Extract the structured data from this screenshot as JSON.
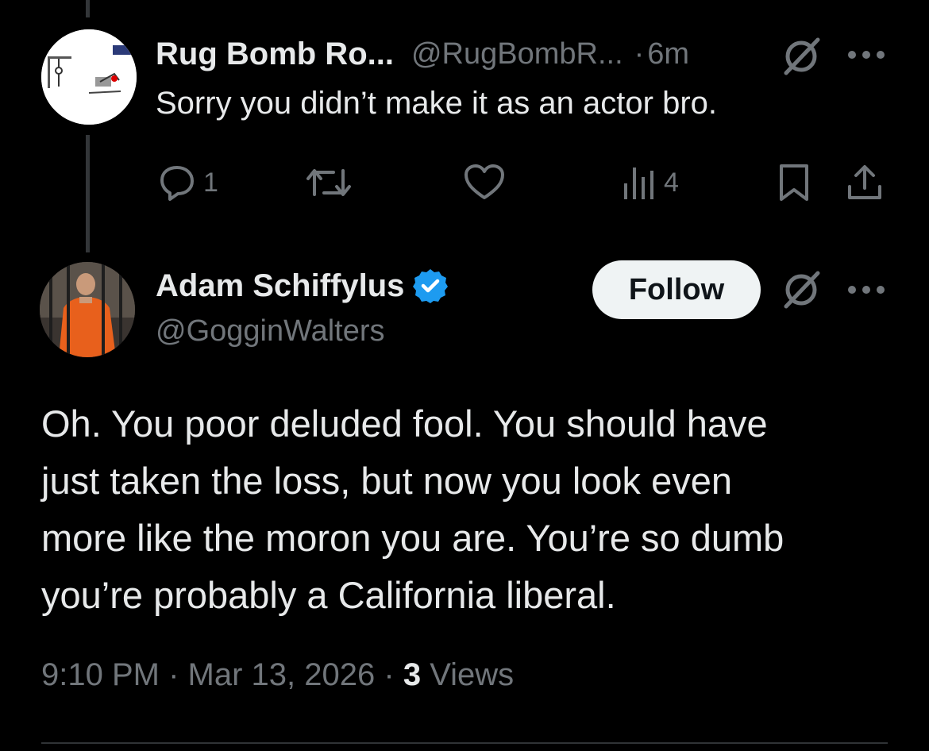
{
  "reply": {
    "display_name": "Rug Bomb Ro...",
    "handle": "@RugBombR...",
    "separator": "·",
    "time": "6m",
    "text": "Sorry you didn’t make it as an actor bro.",
    "actions": {
      "reply_count": "1",
      "repost_count": "",
      "like_count": "",
      "views_count": "4"
    }
  },
  "post": {
    "display_name": "Adam Schiffylus",
    "handle": "@GogginWalters",
    "follow_label": "Follow",
    "verified": true,
    "text_lines": [
      "Oh.  You poor deluded fool.  You should have",
      "just taken the loss, but now you look even",
      "more like the moron you are.  You’re so dumb",
      "you’re probably a California liberal."
    ],
    "time": "9:10 PM",
    "date": "Mar 13, 2026",
    "separator": "·",
    "views_count": "3",
    "views_label": "Views"
  },
  "icons": {
    "reply": "reply-icon",
    "repost": "repost-icon",
    "like": "like-icon",
    "analytics": "analytics-icon",
    "bookmark": "bookmark-icon",
    "share": "share-icon",
    "grok": "grok-icon",
    "more": "more-icon",
    "verified": "verified-badge-icon"
  },
  "colors": {
    "background": "#000000",
    "text_primary": "#e7e9ea",
    "text_secondary": "#71767b",
    "verified_blue": "#1d9bf0",
    "follow_button_bg": "#eff3f4",
    "follow_button_text": "#0f1419"
  }
}
